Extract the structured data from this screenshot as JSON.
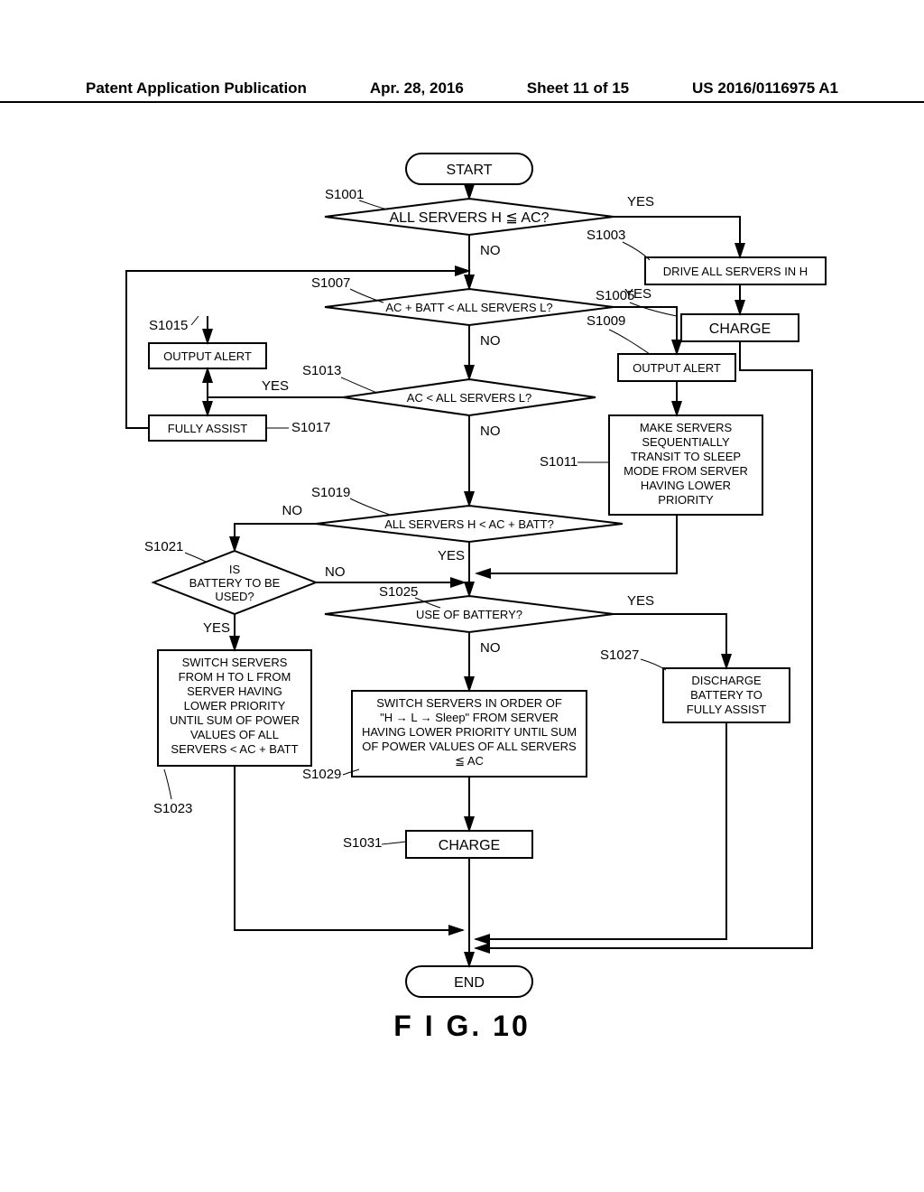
{
  "header": {
    "pub": "Patent Application Publication",
    "date": "Apr. 28, 2016",
    "sheet": "Sheet 11 of 15",
    "docnum": "US 2016/0116975 A1"
  },
  "figure_caption": "F I G.   10",
  "terminals": {
    "start": "START",
    "end": "END"
  },
  "decisions": {
    "s1001": "ALL SERVERS H ≦ AC?",
    "s1007": "AC + BATT < ALL SERVERS L?",
    "s1013": "AC < ALL SERVERS L?",
    "s1019": "ALL SERVERS H < AC + BATT?",
    "s1021_l1": "IS",
    "s1021_l2": "BATTERY TO BE",
    "s1021_l3": "USED?",
    "s1025": "USE OF BATTERY?"
  },
  "processes": {
    "s1003": "DRIVE ALL SERVERS IN H",
    "s1005": "CHARGE",
    "s1009": "OUTPUT ALERT",
    "s1011_l1": "MAKE SERVERS",
    "s1011_l2": "SEQUENTIALLY",
    "s1011_l3": "TRANSIT TO SLEEP",
    "s1011_l4": "MODE FROM SERVER",
    "s1011_l5": "HAVING LOWER",
    "s1011_l6": "PRIORITY",
    "s1015": "OUTPUT ALERT",
    "s1017": "FULLY ASSIST",
    "s1023_l1": "SWITCH SERVERS",
    "s1023_l2": "FROM H TO L FROM",
    "s1023_l3": "SERVER HAVING",
    "s1023_l4": "LOWER PRIORITY",
    "s1023_l5": "UNTIL SUM OF POWER",
    "s1023_l6": "VALUES OF ALL",
    "s1023_l7": "SERVERS < AC + BATT",
    "s1027_l1": "DISCHARGE",
    "s1027_l2": "BATTERY TO",
    "s1027_l3": "FULLY ASSIST",
    "s1029_l1": "SWITCH SERVERS IN ORDER OF",
    "s1029_l2": "\"H → L → Sleep\" FROM SERVER",
    "s1029_l3": "HAVING LOWER PRIORITY UNTIL SUM",
    "s1029_l4": "OF POWER VALUES OF ALL SERVERS",
    "s1029_l5": "≦ AC",
    "s1031": "CHARGE"
  },
  "branches": {
    "yes": "YES",
    "no": "NO"
  },
  "step_labels": {
    "s1001": "S1001",
    "s1003": "S1003",
    "s1005": "S1005",
    "s1007": "S1007",
    "s1009": "S1009",
    "s1011": "S1011",
    "s1013": "S1013",
    "s1015": "S1015",
    "s1017": "S1017",
    "s1019": "S1019",
    "s1021": "S1021",
    "s1023": "S1023",
    "s1025": "S1025",
    "s1027": "S1027",
    "s1029": "S1029",
    "s1031": "S1031"
  }
}
